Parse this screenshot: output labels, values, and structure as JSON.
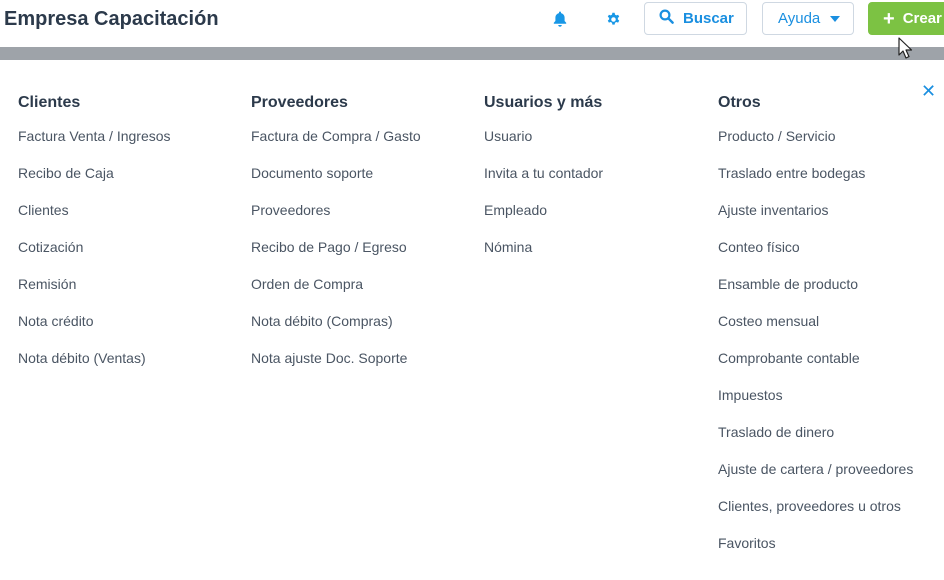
{
  "header": {
    "company": "Empresa Capacitación",
    "bell_icon": "bell-icon",
    "settings_icon": "gear-icon",
    "search_label": "Buscar",
    "help_label": "Ayuda",
    "create_label": "Crear",
    "accent_color": "#1a8fe0",
    "create_color": "#7cc243"
  },
  "menu": {
    "columns": [
      {
        "title": "Clientes",
        "items": [
          "Factura Venta / Ingresos",
          "Recibo de Caja",
          "Clientes",
          "Cotización",
          "Remisión",
          "Nota crédito",
          "Nota débito (Ventas)"
        ]
      },
      {
        "title": "Proveedores",
        "items": [
          "Factura de Compra / Gasto",
          "Documento soporte",
          "Proveedores",
          "Recibo de Pago / Egreso",
          "Orden de Compra",
          "Nota débito (Compras)",
          "Nota ajuste Doc. Soporte"
        ]
      },
      {
        "title": "Usuarios y más",
        "items": [
          "Usuario",
          "Invita a tu contador",
          "Empleado",
          "Nómina"
        ]
      },
      {
        "title": "Otros",
        "items": [
          "Producto / Servicio",
          "Traslado entre bodegas",
          "Ajuste inventarios",
          "Conteo físico",
          "Ensamble de producto",
          "Costeo mensual",
          "Comprobante contable",
          "Impuestos",
          "Traslado de dinero",
          "Ajuste de cartera / proveedores",
          "Clientes, proveedores u otros",
          "Favoritos"
        ]
      }
    ],
    "close_icon": "close-icon"
  }
}
